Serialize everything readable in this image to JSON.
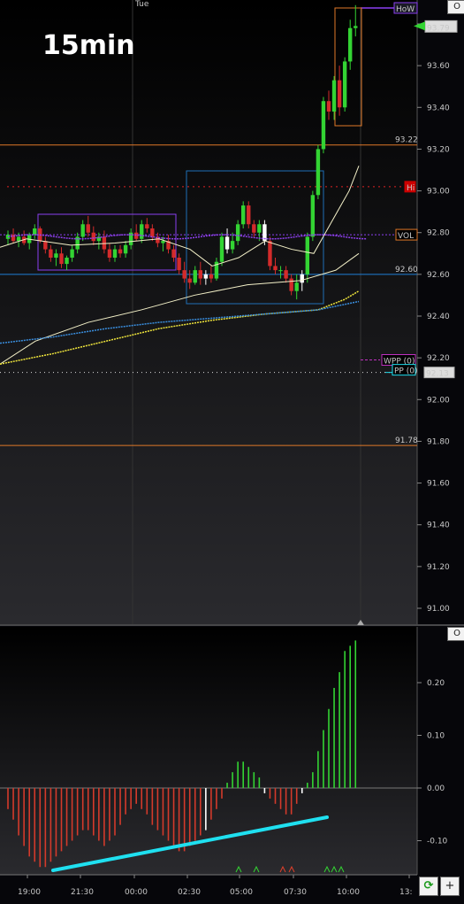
{
  "timeframe_label": "15min",
  "top_day_label": "Tue",
  "panel_buttons": {
    "price": "O",
    "osc": "O"
  },
  "bottom_buttons": {
    "refresh": "⟳",
    "add": "+"
  },
  "colors": {
    "bg": "#06060a",
    "up": "#33d433",
    "down": "#d42b2b",
    "white_candle": "#ffffff",
    "orange": "#e07828",
    "purple": "#8a3ff0",
    "blue": "#1f7fd6",
    "red_dots": "#d22",
    "yellow_ma": "#f0e63c",
    "cream_ma": "#f3f0c8",
    "cyan": "#1fe0f0",
    "grid": "#2a2a30"
  },
  "chart_data": [
    {
      "type": "candlestick",
      "title": "",
      "ylim": [
        90.85,
        93.9
      ],
      "y_ticks": [
        "91.00",
        "91.20",
        "91.40",
        "91.60",
        "91.80",
        "92.00",
        "92.20",
        "92.40",
        "92.60",
        "92.80",
        "93.00",
        "93.20",
        "93.40",
        "93.60",
        "93.80"
      ],
      "last_price": "93.79",
      "levels": [
        {
          "name": "HoW",
          "value": 93.89,
          "color": "#8a3ff0",
          "label": "HoW"
        },
        {
          "name": "orange-high",
          "value": 93.22,
          "color": "#e07828",
          "label": "93.22"
        },
        {
          "name": "Hi",
          "value": 93.02,
          "color": "#d22",
          "label": "Hi"
        },
        {
          "name": "VOL",
          "value": 92.79,
          "color": "#e07828",
          "label": "VOL"
        },
        {
          "name": "blue-level",
          "value": 92.6,
          "color": "#1f7fd6",
          "label": "92.60"
        },
        {
          "name": "WPP",
          "value": 92.19,
          "color": "#c030c0",
          "label": "WPP (0)"
        },
        {
          "name": "PP",
          "value": 92.13,
          "color": "#1fe0f0",
          "label": "PP (0)"
        },
        {
          "name": "prev-close",
          "value": 92.13,
          "color": "#ffffff",
          "label": "92.13"
        },
        {
          "name": "orange-low",
          "value": 91.78,
          "color": "#e07828",
          "label": "91.78"
        }
      ],
      "candles": [
        [
          92.77,
          92.81,
          92.74,
          92.79
        ],
        [
          92.79,
          92.82,
          92.75,
          92.76
        ],
        [
          92.76,
          92.8,
          92.73,
          92.78
        ],
        [
          92.78,
          92.81,
          92.74,
          92.75
        ],
        [
          92.75,
          92.8,
          92.72,
          92.79
        ],
        [
          92.79,
          92.84,
          92.77,
          92.82
        ],
        [
          92.82,
          92.83,
          92.75,
          92.76
        ],
        [
          92.76,
          92.78,
          92.7,
          92.72
        ],
        [
          92.72,
          92.74,
          92.66,
          92.68
        ],
        [
          92.68,
          92.72,
          92.64,
          92.7
        ],
        [
          92.7,
          92.73,
          92.63,
          92.65
        ],
        [
          92.65,
          92.69,
          92.62,
          92.68
        ],
        [
          92.68,
          92.74,
          92.66,
          92.72
        ],
        [
          92.72,
          92.8,
          92.7,
          92.78
        ],
        [
          92.78,
          92.86,
          92.76,
          92.84
        ],
        [
          92.84,
          92.88,
          92.78,
          92.8
        ],
        [
          92.8,
          92.83,
          92.74,
          92.76
        ],
        [
          92.76,
          92.8,
          92.72,
          92.78
        ],
        [
          92.78,
          92.81,
          92.7,
          92.72
        ],
        [
          92.72,
          92.75,
          92.66,
          92.68
        ],
        [
          92.68,
          92.74,
          92.66,
          92.72
        ],
        [
          92.72,
          92.74,
          92.68,
          92.7
        ],
        [
          92.7,
          92.76,
          92.68,
          92.74
        ],
        [
          92.74,
          92.82,
          92.72,
          92.8
        ],
        [
          92.8,
          92.84,
          92.76,
          92.77
        ],
        [
          92.77,
          92.86,
          92.75,
          92.84
        ],
        [
          92.84,
          92.87,
          92.8,
          92.82
        ],
        [
          92.82,
          92.84,
          92.76,
          92.78
        ],
        [
          92.78,
          92.8,
          92.73,
          92.75
        ],
        [
          92.75,
          92.78,
          92.71,
          92.76
        ],
        [
          92.76,
          92.79,
          92.7,
          92.72
        ],
        [
          92.72,
          92.74,
          92.66,
          92.68
        ],
        [
          92.68,
          92.7,
          92.6,
          92.62
        ],
        [
          92.62,
          92.66,
          92.56,
          92.58
        ],
        [
          92.58,
          92.62,
          92.53,
          92.56
        ],
        [
          92.56,
          92.64,
          92.55,
          92.62
        ],
        [
          92.62,
          92.66,
          92.55,
          92.58
        ],
        [
          92.58,
          92.62,
          92.55,
          92.6
        ],
        [
          92.6,
          92.64,
          92.56,
          92.58
        ],
        [
          92.58,
          92.68,
          92.57,
          92.66
        ],
        [
          92.66,
          92.8,
          92.64,
          92.78
        ],
        [
          92.78,
          92.82,
          92.7,
          92.72
        ],
        [
          92.72,
          92.8,
          92.7,
          92.76
        ],
        [
          92.76,
          92.86,
          92.74,
          92.84
        ],
        [
          92.84,
          92.95,
          92.82,
          92.93
        ],
        [
          92.93,
          92.95,
          92.82,
          92.84
        ],
        [
          92.84,
          92.86,
          92.78,
          92.8
        ],
        [
          92.8,
          92.86,
          92.76,
          92.84
        ],
        [
          92.84,
          92.86,
          92.74,
          92.76
        ],
        [
          92.76,
          92.78,
          92.62,
          92.64
        ],
        [
          92.64,
          92.68,
          92.6,
          92.62
        ],
        [
          92.62,
          92.64,
          92.58,
          92.62
        ],
        [
          92.62,
          92.64,
          92.56,
          92.58
        ],
        [
          92.58,
          92.6,
          92.5,
          92.52
        ],
        [
          92.52,
          92.6,
          92.48,
          92.56
        ],
        [
          92.56,
          92.62,
          92.52,
          92.6
        ],
        [
          92.6,
          92.8,
          92.56,
          92.78
        ],
        [
          92.78,
          93.0,
          92.76,
          92.98
        ],
        [
          92.98,
          93.22,
          92.96,
          93.2
        ],
        [
          93.2,
          93.45,
          93.18,
          93.43
        ],
        [
          93.43,
          93.48,
          93.34,
          93.38
        ],
        [
          93.38,
          93.55,
          93.34,
          93.53
        ],
        [
          93.53,
          93.6,
          93.36,
          93.4
        ],
        [
          93.4,
          93.64,
          93.38,
          93.62
        ],
        [
          93.62,
          93.82,
          93.58,
          93.78
        ],
        [
          93.78,
          93.89,
          93.74,
          93.79
        ]
      ],
      "osc_label_ticks": [
        "0.20",
        "0.10",
        "0.00",
        "-0.10"
      ],
      "osc_ylim": [
        -0.16,
        0.29
      ],
      "x_ticks": [
        "19:00",
        "21:30",
        "00:00",
        "02:30",
        "05:00",
        "07:30",
        "10:00",
        "13:"
      ]
    }
  ]
}
